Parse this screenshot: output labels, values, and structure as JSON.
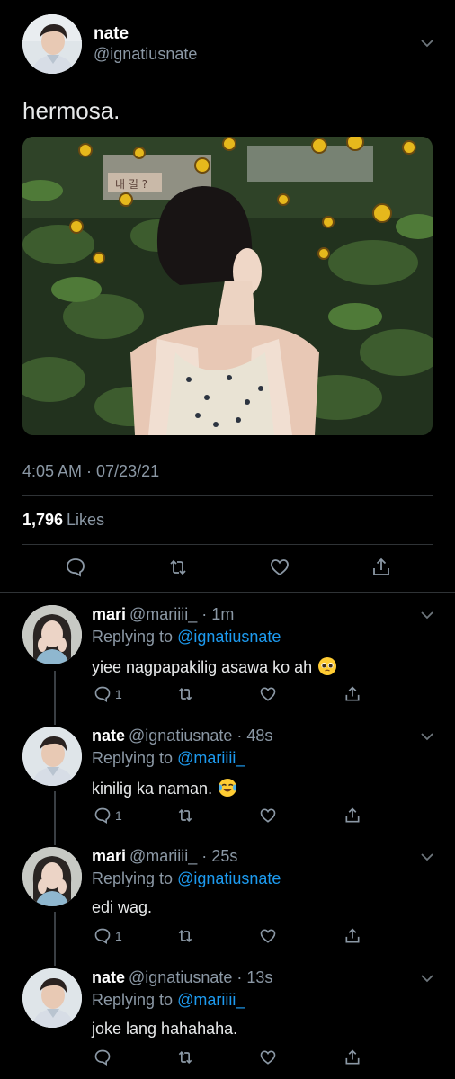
{
  "main_tweet": {
    "name": "nate",
    "handle": "@ignatiusnate",
    "text": "hermosa.",
    "timestamp": "4:05 AM · 07/23/21",
    "likes_count": "1,796",
    "likes_label": "Likes",
    "photo_sign_text": "내 길 ?"
  },
  "replies": [
    {
      "name": "mari",
      "meta": "@mariiii_ · 1m",
      "replying_prefix": "Replying to",
      "replying_to": "@ignatiusnate",
      "text": "yiee nagpapakilig asawa ko ah",
      "emoji": "pleading-face",
      "reply_count": "1"
    },
    {
      "name": "nate",
      "meta": "@ignatiusnate · 48s",
      "replying_prefix": "Replying to",
      "replying_to": "@mariiii_",
      "text": "kinilig ka naman.",
      "emoji": "tears-of-joy",
      "reply_count": "1"
    },
    {
      "name": "mari",
      "meta": "@mariiii_ · 25s",
      "replying_prefix": "Replying to",
      "replying_to": "@ignatiusnate",
      "text": "edi wag.",
      "emoji": "",
      "reply_count": "1"
    },
    {
      "name": "nate",
      "meta": "@ignatiusnate · 13s",
      "replying_prefix": "Replying to",
      "replying_to": "@mariiii_",
      "text": "joke lang hahahaha.",
      "emoji": "",
      "reply_count": ""
    }
  ],
  "colors": {
    "background": "#000000",
    "secondary_text": "#8b98a5",
    "link": "#1d9bf0",
    "divider": "#2f3336"
  }
}
